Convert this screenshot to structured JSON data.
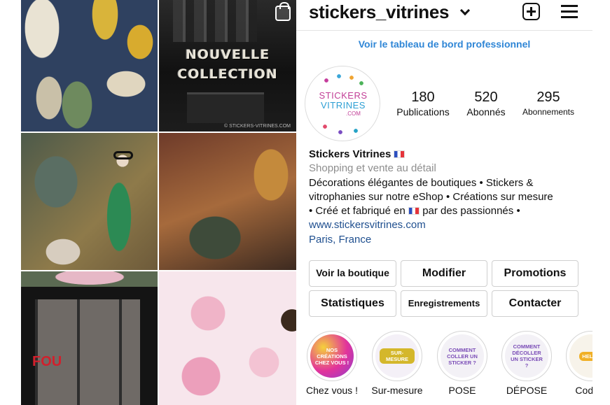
{
  "grid": {
    "tile2": {
      "headline_line1": "NOUVELLE",
      "headline_line2": "COLLECTION",
      "watermark": "© STICKERS-VITRINES.COM"
    },
    "tile5": {
      "shop_text": "FOU"
    }
  },
  "header": {
    "username": "stickers_vitrines",
    "icons": [
      "chevron-down-icon",
      "new-post-icon",
      "menu-icon",
      "shopping-bag-icon"
    ]
  },
  "dashboard_link": "Voir le tableau de bord professionnel",
  "avatar": {
    "logo_line1": "STICKERS",
    "logo_line2": "VITRINES",
    "logo_suffix": ".COM"
  },
  "stats": [
    {
      "value": "180",
      "label": "Publications"
    },
    {
      "value": "520",
      "label": "Abonnés"
    },
    {
      "value": "295",
      "label": "Abonnements"
    }
  ],
  "bio": {
    "name": "Stickers Vitrines",
    "category": "Shopping et vente au détail",
    "line1": "Décorations élégantes de boutiques • Stickers &",
    "line2": "vitrophanies sur notre eShop • Créations sur mesure",
    "line3_a": "• Créé et fabriqué en",
    "line3_b": "par des passionnés •",
    "website": "www.stickersvitrines.com",
    "location": "Paris, France"
  },
  "buttons": {
    "shop": "Voir la boutique",
    "edit": "Modifier",
    "promotions": "Promotions",
    "stats": "Statistiques",
    "saved": "Enregistrements",
    "contact": "Contacter"
  },
  "highlights": [
    {
      "caption": "Chez vous !",
      "text": "NOS CRÉATIONS CHEZ VOUS !"
    },
    {
      "caption": "Sur-mesure",
      "text": "SUR-MESURE"
    },
    {
      "caption": "POSE",
      "text": "COMMENT COLLER UN STICKER ?"
    },
    {
      "caption": "DÉPOSE",
      "text": "COMMENT DÉCOLLER UN STICKER ?"
    },
    {
      "caption": "Code p",
      "text": "HELLO"
    }
  ]
}
